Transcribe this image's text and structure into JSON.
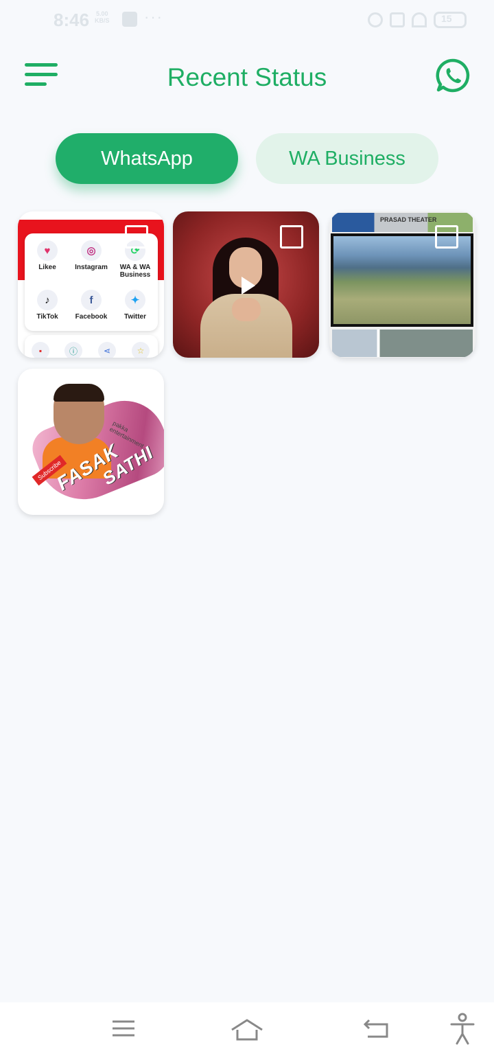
{
  "status_bar": {
    "time": "8:46",
    "network_top": "5.00",
    "network_bottom": "KB/S",
    "dots": "···",
    "battery": "15"
  },
  "header": {
    "title": "Recent Status"
  },
  "tabs": [
    {
      "label": "WhatsApp",
      "active": true
    },
    {
      "label": "WA Business",
      "active": false
    }
  ],
  "colors": {
    "accent": "#1fae64",
    "tab_active_bg": "#20ae6a",
    "tab_inactive_bg": "#e2f3ea",
    "background": "#f7f9fc"
  },
  "statuses": [
    {
      "kind": "image",
      "apps": [
        "Likee",
        "Instagram",
        "WA & WA Business",
        "TikTok",
        "Facebook",
        "Twitter"
      ]
    },
    {
      "kind": "video"
    },
    {
      "kind": "image",
      "sign_text": "PRASAD THEATER"
    },
    {
      "kind": "image",
      "title_line1": "FASAK",
      "title_line2": "SATHI",
      "subscribe": "Subscribe",
      "tagline": "pakka entertainment"
    }
  ],
  "bottom_nav": [
    "menu-icon",
    "home-icon",
    "back-icon",
    "accessibility-icon"
  ]
}
